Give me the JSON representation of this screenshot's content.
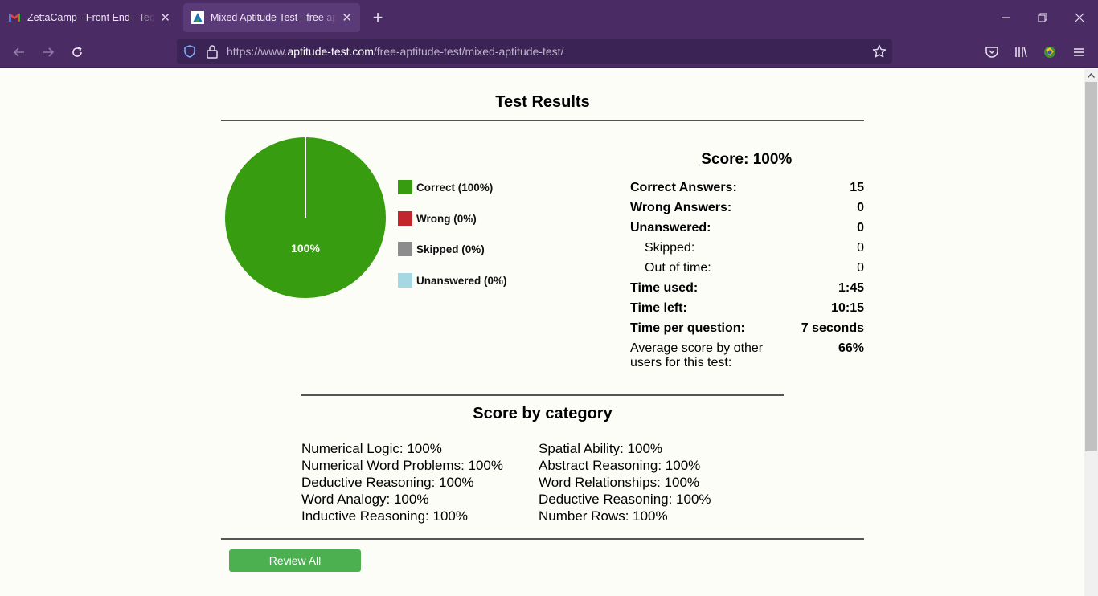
{
  "browser": {
    "tabs": [
      {
        "title": "ZettaCamp - Front End - Techni",
        "icon": "gmail-icon"
      },
      {
        "title": "Mixed Aptitude Test - free aptitu",
        "icon": "aptitude-test-icon"
      }
    ],
    "url": {
      "prefix": "https://www.",
      "domain": "aptitude-test.com",
      "path": "/free-aptitude-test/mixed-aptitude-test/"
    }
  },
  "results": {
    "title": "Test Results",
    "score_label": " Score: 100% ",
    "chart_data": {
      "type": "pie",
      "slices": [
        {
          "label": "Correct (100%)",
          "value": 100,
          "color": "#379c10"
        },
        {
          "label": "Wrong (0%)",
          "value": 0,
          "color": "#c1272d"
        },
        {
          "label": "Skipped (0%)",
          "value": 0,
          "color": "#8c8c8c"
        },
        {
          "label": "Unanswered (0%)",
          "value": 0,
          "color": "#a6d8e3"
        }
      ],
      "center_label": "100%"
    },
    "stats": [
      {
        "label": "Correct Answers:",
        "value": "15"
      },
      {
        "label": "Wrong Answers:",
        "value": "0"
      },
      {
        "label": "Unanswered:",
        "value": "0"
      },
      {
        "label": "Skipped:",
        "value": "0"
      },
      {
        "label": "Out of time:",
        "value": "0"
      },
      {
        "label": "Time used:",
        "value": "1:45"
      },
      {
        "label": "Time left:",
        "value": "10:15"
      },
      {
        "label": "Time per question:",
        "value": "7 seconds"
      },
      {
        "label": "Average score by other users for this test:",
        "value": "66%"
      }
    ]
  },
  "categories": {
    "title": "Score by category",
    "left": [
      "Numerical Logic: 100%",
      "Numerical Word Problems: 100%",
      "Deductive Reasoning: 100%",
      "Word Analogy: 100%",
      "Inductive Reasoning: 100%"
    ],
    "right": [
      "Spatial Ability: 100%",
      "Abstract Reasoning: 100%",
      "Word Relationships: 100%",
      "Deductive Reasoning: 100%",
      "Number Rows: 100%"
    ]
  },
  "actions": {
    "review_all": "Review All"
  }
}
